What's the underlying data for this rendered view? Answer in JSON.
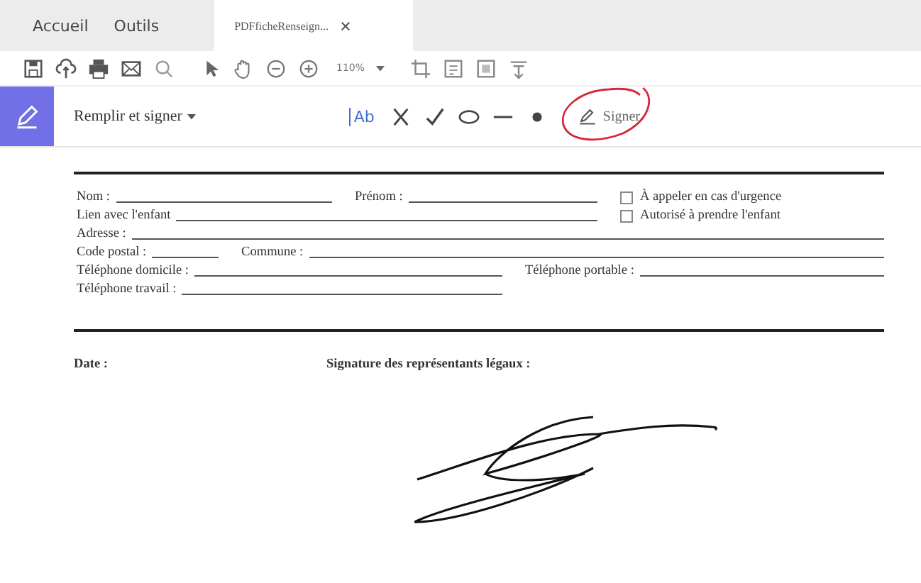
{
  "menu_tabs": [
    {
      "label": "Accueil",
      "selected": false
    },
    {
      "label": "Outils",
      "selected": false
    },
    {
      "label": "PDFficheRenseign...",
      "selected": true,
      "kind": "document"
    }
  ],
  "toolbar": {
    "zoom": "110%"
  },
  "fill_sign_bar": {
    "title": "Remplir et signer",
    "text_tool": "Ab",
    "sign_button": "Signer",
    "sign_circled": true
  },
  "form": {
    "rows": [
      [
        {
          "kind": "field",
          "label": "Nom :"
        },
        {
          "kind": "field",
          "label": "Prénom :"
        }
      ],
      [
        {
          "kind": "field",
          "label": "Lien avec l'enfant"
        }
      ],
      [
        {
          "kind": "field",
          "label": "Adresse :"
        }
      ],
      [
        {
          "kind": "field",
          "label": "Code postal :"
        },
        {
          "kind": "field",
          "label": "Commune :"
        }
      ],
      [
        {
          "kind": "field",
          "label": "Téléphone domicile :"
        },
        {
          "kind": "field",
          "label": "Téléphone portable :"
        }
      ],
      [
        {
          "kind": "field",
          "label": "Téléphone travail :"
        }
      ]
    ],
    "options": [
      {
        "label": "À appeler en cas d'urgence",
        "checked": false
      },
      {
        "label": "Autorisé à prendre l'enfant",
        "checked": false
      }
    ]
  },
  "signature_section": {
    "date_label": "Date :",
    "signature_label": "Signature des représentants légaux :",
    "signed": true
  }
}
